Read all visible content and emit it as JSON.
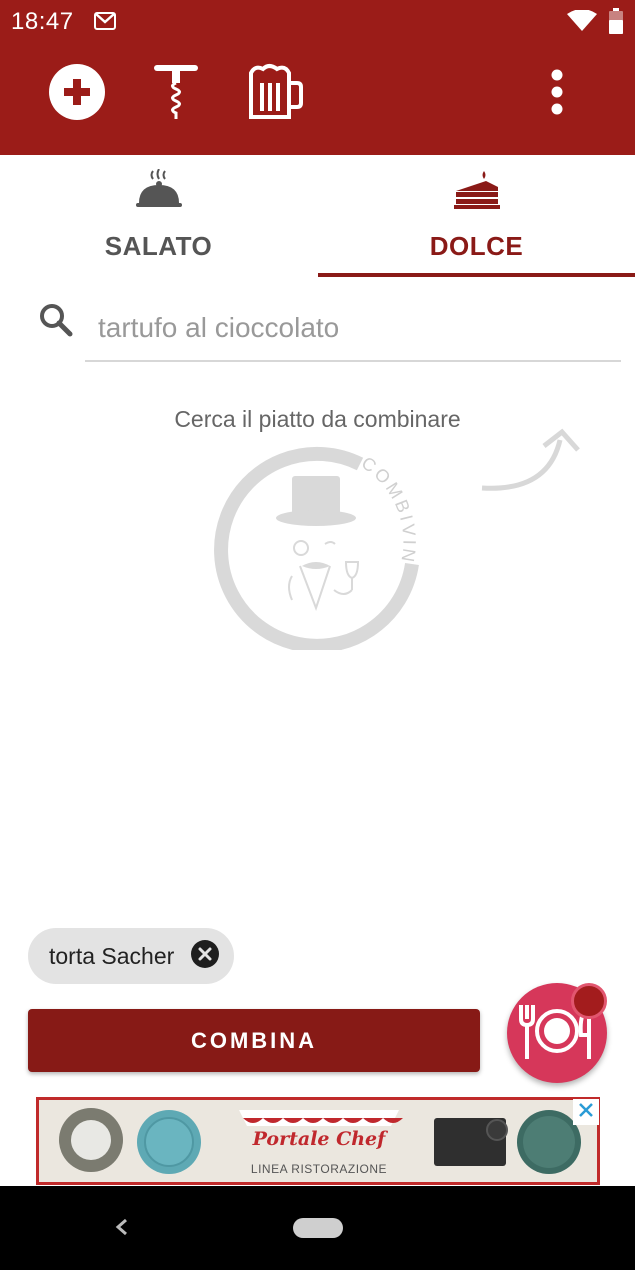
{
  "status_bar": {
    "time": "18:47"
  },
  "toolbar": {
    "add_icon": "add-circle-icon",
    "corkscrew_icon": "corkscrew-icon",
    "beer_icon": "beer-mug-icon",
    "more_icon": "more-vert-icon"
  },
  "tabs": [
    {
      "label": "SALATO",
      "icon": "cloche-icon",
      "selected": false
    },
    {
      "label": "DOLCE",
      "icon": "cake-icon",
      "selected": true
    }
  ],
  "search": {
    "value": "",
    "placeholder": "tartufo al cioccolato"
  },
  "hint": {
    "text": "Cerca il piatto da combinare"
  },
  "logo": {
    "text": "COMBIVINO"
  },
  "chips": [
    {
      "label": "torta Sacher"
    }
  ],
  "actions": {
    "combine_label": "COMBINA",
    "fab_icon": "plate-cutlery-icon"
  },
  "ad": {
    "title": "Portale Chef",
    "subtitle": "LINEA RISTORAZIONE"
  },
  "colors": {
    "primary": "#9b1c18",
    "accent": "#8a1a17",
    "fab": "#d6375a"
  }
}
